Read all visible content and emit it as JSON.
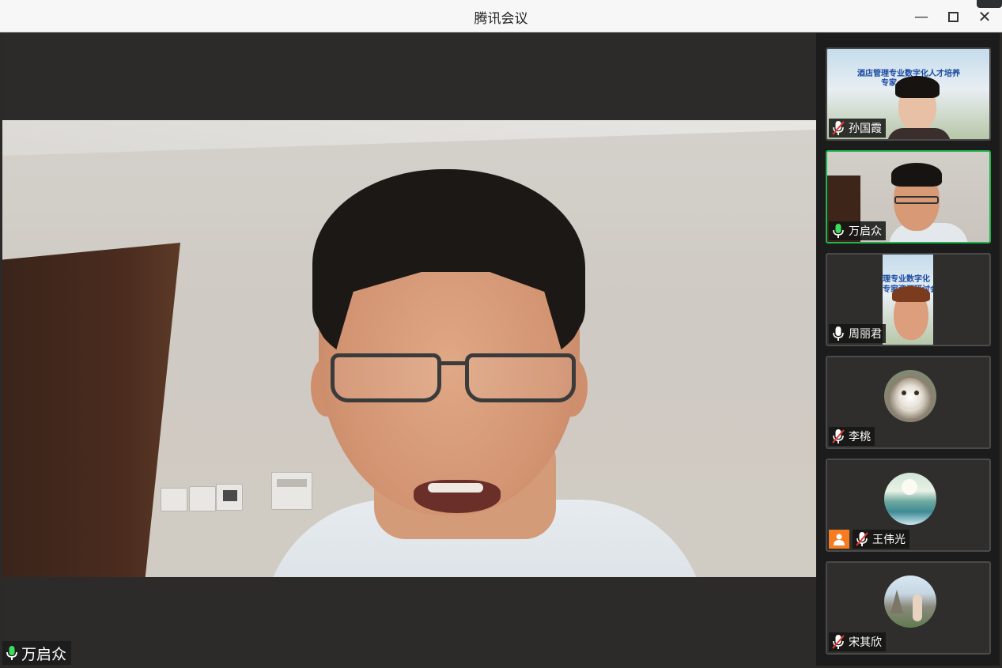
{
  "window": {
    "title": "腾讯会议"
  },
  "main_video": {
    "speaker_name": "万启众",
    "mic_state": "speaking"
  },
  "participants": [
    {
      "name": "孙国霞",
      "mic_state": "muted",
      "video": "camera-with-slide",
      "slide_text_1": "酒店管理专业数字化人才培养",
      "slide_text_2": "专家"
    },
    {
      "name": "万启众",
      "mic_state": "speaking",
      "video": "camera",
      "active": true
    },
    {
      "name": "周丽君",
      "mic_state": "unmuted",
      "video": "camera-with-slide",
      "slide_text_1": "理专业数字化",
      "slide_text_2": "专家资源研讨会"
    },
    {
      "name": "李桃",
      "mic_state": "muted",
      "video": "avatar",
      "avatar": "cat-photo-avatar"
    },
    {
      "name": "王伟光",
      "mic_state": "muted",
      "video": "avatar",
      "avatar": "landscape-avatar",
      "badge": "host-icon"
    },
    {
      "name": "宋其欣",
      "mic_state": "muted",
      "video": "avatar",
      "avatar": "tourist-photo-avatar"
    }
  ],
  "colors": {
    "active_border": "#21b34d",
    "speaking_mic": "#3ddc5a",
    "badge": "#f57c21"
  }
}
